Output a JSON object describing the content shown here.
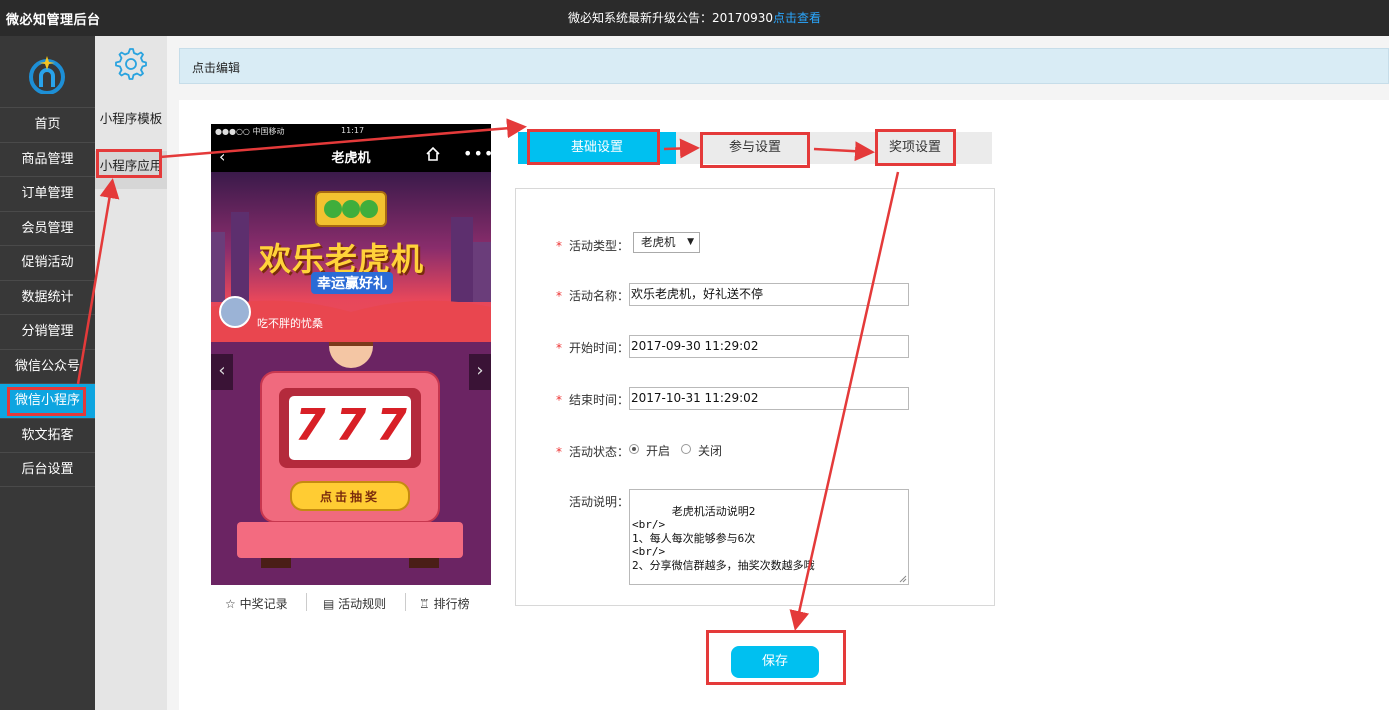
{
  "topbar": {
    "brand": "微必知管理后台",
    "notice_text": "微必知系统最新升级公告：20170930",
    "notice_link": "点击查看"
  },
  "sidebar": {
    "items": [
      {
        "label": "首页"
      },
      {
        "label": "商品管理"
      },
      {
        "label": "订单管理"
      },
      {
        "label": "会员管理"
      },
      {
        "label": "促销活动"
      },
      {
        "label": "数据统计"
      },
      {
        "label": "分销管理"
      },
      {
        "label": "微信公众号"
      },
      {
        "label": "微信小程序"
      },
      {
        "label": "软文拓客"
      },
      {
        "label": "后台设置"
      }
    ],
    "active_index": 8
  },
  "subnav": {
    "items": [
      {
        "label": "小程序模板"
      },
      {
        "label": "小程序应用"
      }
    ]
  },
  "editbar": {
    "label": "点击编辑"
  },
  "phone": {
    "carrier": "●●●○○ 中国移动",
    "time": "11:17",
    "title": "老虎机",
    "banner_main": "欢乐老虎机",
    "banner_sub": "幸运赢好礼",
    "username": "吃不胖的忧桑",
    "reels": "777",
    "draw_button": "点击抽奖",
    "tabs": [
      "中奖记录",
      "活动规则",
      "排行榜"
    ]
  },
  "tabs": [
    {
      "label": "基础设置",
      "active": true
    },
    {
      "label": "参与设置",
      "active": false
    },
    {
      "label": "奖项设置",
      "active": false
    }
  ],
  "form": {
    "type_label": "活动类型：",
    "type_value": "老虎机",
    "name_label": "活动名称：",
    "name_value": "欢乐老虎机，好礼送不停",
    "start_label": "开始时间：",
    "start_value": "2017-09-30 11:29:02",
    "end_label": "结束时间：",
    "end_value": "2017-10-31 11:29:02",
    "status_label": "活动状态：",
    "status_on": "开启",
    "status_off": "关闭",
    "status_selected": "开启",
    "desc_label": "活动说明：",
    "desc_value": "老虎机活动说明2\n<br/>\n1、每人每次能够参与6次\n<br/>\n2、分享微信群越多，抽奖次数越多哦"
  },
  "save_label": "保存",
  "colors": {
    "accent": "#00c0f0",
    "active_nav": "#0ea5e0",
    "highlight": "#e43a3a",
    "topbar": "#2b2b2b",
    "sidebar": "#383838"
  }
}
